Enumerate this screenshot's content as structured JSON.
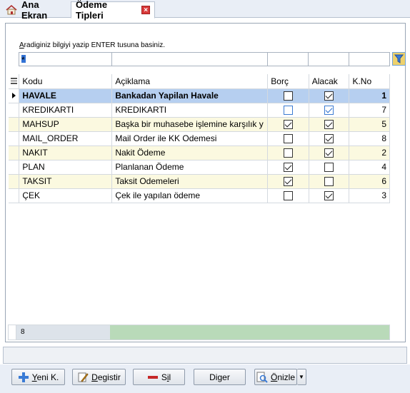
{
  "tabs": [
    {
      "label": "Ana Ekran"
    },
    {
      "label": "Ödeme Tipleri"
    }
  ],
  "search": {
    "label_underlined": "A",
    "label_rest": "radiginiz bilgiyi yazip ENTER tusuna basiniz.",
    "filter_value": "*"
  },
  "grid": {
    "columns": [
      "Kodu",
      "Açiklama",
      "Borç",
      "Alacak",
      "K.No"
    ],
    "rows": [
      {
        "kod": "HAVALE",
        "aciklama": "Bankadan Yapilan Havale",
        "borc": false,
        "alacak": true,
        "kno": "1",
        "selected": true
      },
      {
        "kod": "KREDIKARTI",
        "aciklama": "KREDIKARTI",
        "borc": false,
        "alacak": true,
        "kno": "7",
        "blue": true
      },
      {
        "kod": "MAHSUP",
        "aciklama": "Başka bir muhasebe işlemine karşılık y",
        "borc": true,
        "alacak": true,
        "kno": "5"
      },
      {
        "kod": "MAIL_ORDER",
        "aciklama": "Mail Order ile KK Odemesi",
        "borc": false,
        "alacak": true,
        "kno": "8"
      },
      {
        "kod": "NAKIT",
        "aciklama": "Nakit Ödeme",
        "borc": false,
        "alacak": true,
        "kno": "2"
      },
      {
        "kod": "PLAN",
        "aciklama": "Planlanan Ödeme",
        "borc": true,
        "alacak": false,
        "kno": "4"
      },
      {
        "kod": "TAKSIT",
        "aciklama": "Taksit Odemeleri",
        "borc": true,
        "alacak": false,
        "kno": "6"
      },
      {
        "kod": "ÇEK",
        "aciklama": "Çek ile yapılan ödeme",
        "borc": false,
        "alacak": true,
        "kno": "3"
      }
    ],
    "row_count": "8"
  },
  "buttons": {
    "new": {
      "u": "Y",
      "rest": "eni K."
    },
    "edit": {
      "u": "D",
      "rest": "egistir"
    },
    "delete": {
      "pre": "S",
      "u": "i",
      "rest": "l"
    },
    "other": {
      "pre": "Di",
      "u": "g",
      "rest": "er"
    },
    "preview": {
      "u": "Ö",
      "rest": "nizle"
    }
  },
  "colors": {
    "selected_row": "#b6cff0",
    "alt_row": "#fbf9e0",
    "footer_bar": "#b9dab9"
  }
}
